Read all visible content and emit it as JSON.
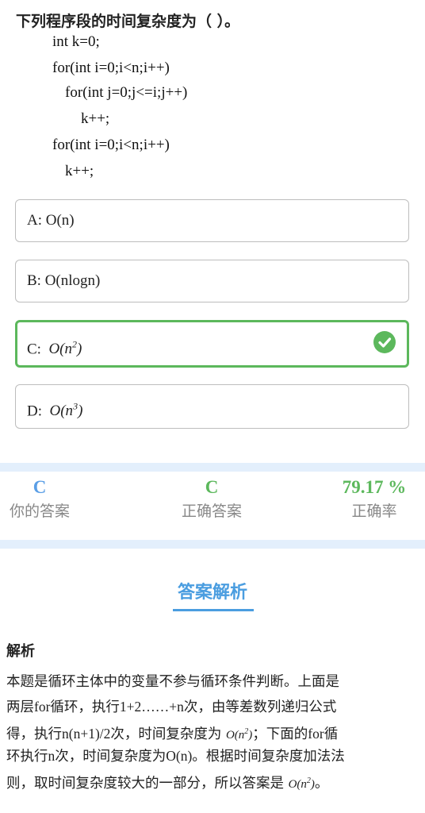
{
  "question": {
    "title": "下列程序段的时间复杂度为（ ）。",
    "code_lines": [
      "int k=0;",
      "for(int i=0;i<n;i++)",
      "for(int j=0;j<=i;j++)",
      "k++;",
      "for(int i=0;i<n;i++)",
      "k++;"
    ]
  },
  "options": [
    {
      "letter": "A:",
      "text": "O(n)"
    },
    {
      "letter": "B:",
      "text": "O(nlogn)"
    },
    {
      "letter": "C:",
      "base": "O(n",
      "exp": "2",
      "close": ")",
      "correct": true
    },
    {
      "letter": "D:",
      "base": "O(n",
      "exp": "3",
      "close": ")"
    }
  ],
  "stats": {
    "your_answer": {
      "value": "C",
      "label": "你的答案",
      "color": "#5a9ee6"
    },
    "correct_answer": {
      "value": "C",
      "label": "正确答案",
      "color": "#5cb85c"
    },
    "accuracy": {
      "value": "79.17 %",
      "label": "正确率",
      "color": "#5cb85c"
    }
  },
  "analysis": {
    "header": "答案解析",
    "label": "解析",
    "line1": "本题是循环主体中的变量不参与循环条件判断。上面是",
    "line2_a": "两层",
    "line2_b": "for",
    "line2_c": "循环，执行",
    "line2_d": "1+2……+n",
    "line2_e": "次，由等差数列递归公式",
    "line3_a": "得，执行",
    "line3_b": "n(n+1)/2",
    "line3_c": "次，时间复杂度为 ",
    "line3_math": "O(n",
    "line3_exp": "2",
    "line3_close": ")",
    "line3_d": "；下面的",
    "line3_e": "for",
    "line3_f": "循",
    "line4_a": "环执行",
    "line4_b": "n",
    "line4_c": "次，时间复杂度为",
    "line4_d": "O(n)",
    "line4_e": "。根据时间复杂度加法法",
    "line5_a": "则，取时间复杂度较大的一部分，所以答案是 ",
    "line5_math": "O(n",
    "line5_exp": "2",
    "line5_close": ")",
    "line5_b": "。"
  },
  "colors": {
    "accent_blue": "#4a9de0",
    "correct_green": "#5cb85c",
    "band": "#e3effc"
  }
}
